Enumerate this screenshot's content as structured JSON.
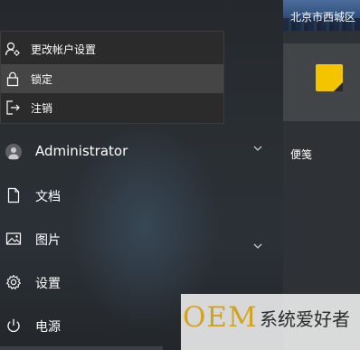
{
  "tiles": {
    "weather_label": "北京市西城区",
    "sticky_label": "便笺",
    "sticky_color": "#f5c400"
  },
  "flyout": {
    "items": [
      {
        "icon": "account-settings-icon",
        "label": "更改帐户设置"
      },
      {
        "icon": "lock-icon",
        "label": "锁定"
      },
      {
        "icon": "sign-out-icon",
        "label": "注销"
      }
    ]
  },
  "rail": {
    "user_name": "Administrator",
    "documents_label": "文档",
    "pictures_label": "图片",
    "settings_label": "设置",
    "power_label": "电源"
  },
  "watermark": {
    "brand": "OEM",
    "site_text": "系统爱好者"
  }
}
